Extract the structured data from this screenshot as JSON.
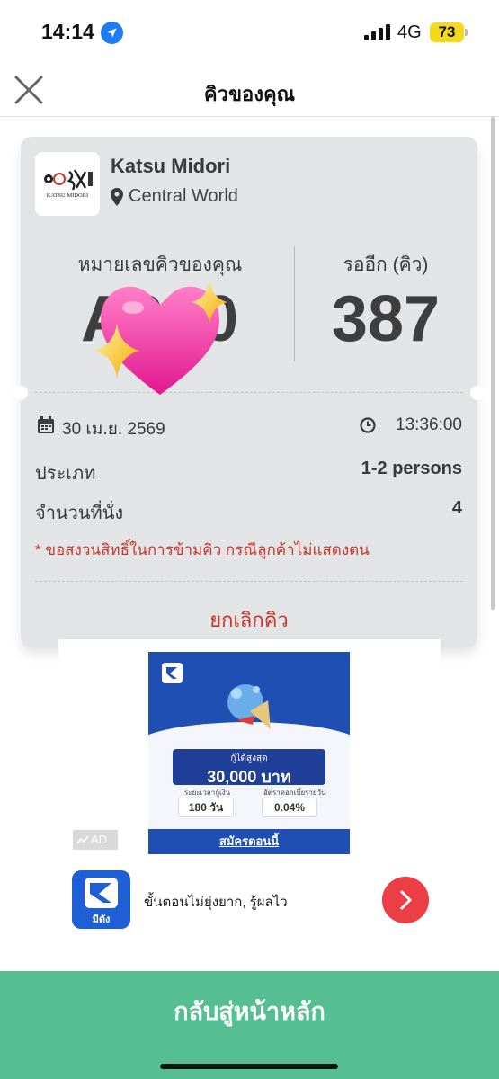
{
  "status_bar": {
    "time": "14:14",
    "network": "4G",
    "battery": "73"
  },
  "header": {
    "title": "คิวของคุณ"
  },
  "ticket": {
    "store_name": "Katsu Midori",
    "store_logo_text": "KATSU MIDORI",
    "branch": "Central World",
    "queue_label": "หมายเลขคิวของคุณ",
    "queue_number": "A000",
    "wait_label": "รออีก (คิว)",
    "wait_count": "387",
    "date": "30 เม.ย. 2569",
    "time": "13:36:00",
    "type_label": "ประเภท",
    "type_value": "1-2 persons",
    "seats_label": "จำนวนที่นั่ง",
    "seats_value": "4",
    "notice": "* ขอสงวนสิทธิ์ในการข้ามคิว กรณีลูกค้าไม่แสดงตน",
    "cancel_label": "ยกเลิกคิว"
  },
  "ad": {
    "badge": "AD",
    "banner_loan_label": "กู้ได้สูงสุด",
    "banner_loan_amount": "30,000 บาท",
    "banner_term_label": "ระยะเวลากู้เงิน",
    "banner_term_value": "180 วัน",
    "banner_rate_label": "อัตราดอกเบี้ยรายวัน",
    "banner_rate_value": "0.04%",
    "banner_cta": "สมัครตอนนี้",
    "app_name": "มีตัง",
    "tagline": "ขั้นตอนไม่ยุ่งยาก, รู้ผลไว"
  },
  "footer": {
    "home_button": "กลับสู่หน้าหลัก"
  },
  "colors": {
    "accent_green": "#55bf93",
    "danger_red": "#c8372d",
    "ad_blue": "#1f4fb3"
  },
  "icons": [
    "location-arrow-icon",
    "signal-icon",
    "close-icon",
    "map-pin-icon",
    "calendar-icon",
    "clock-icon",
    "heart-sparkle-sticker",
    "chevron-right-icon"
  ]
}
